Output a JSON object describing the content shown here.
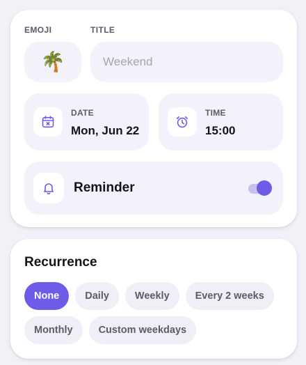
{
  "event": {
    "emoji_label": "EMOJI",
    "emoji": "🌴",
    "title_label": "TITLE",
    "title_value": "",
    "title_placeholder": "Weekend",
    "date_label": "DATE",
    "date_value": "Mon, Jun 22",
    "time_label": "TIME",
    "time_value": "15:00",
    "reminder_label": "Reminder",
    "reminder_on": true
  },
  "recurrence": {
    "title": "Recurrence",
    "options": [
      "None",
      "Daily",
      "Weekly",
      "Every 2 weeks",
      "Monthly",
      "Custom weekdays"
    ],
    "selected": "None"
  },
  "colors": {
    "accent": "#6c5ce7",
    "tile_bg": "#f3f1fa",
    "chip_bg": "#f0eef6",
    "muted_text": "#5d5a6a"
  }
}
